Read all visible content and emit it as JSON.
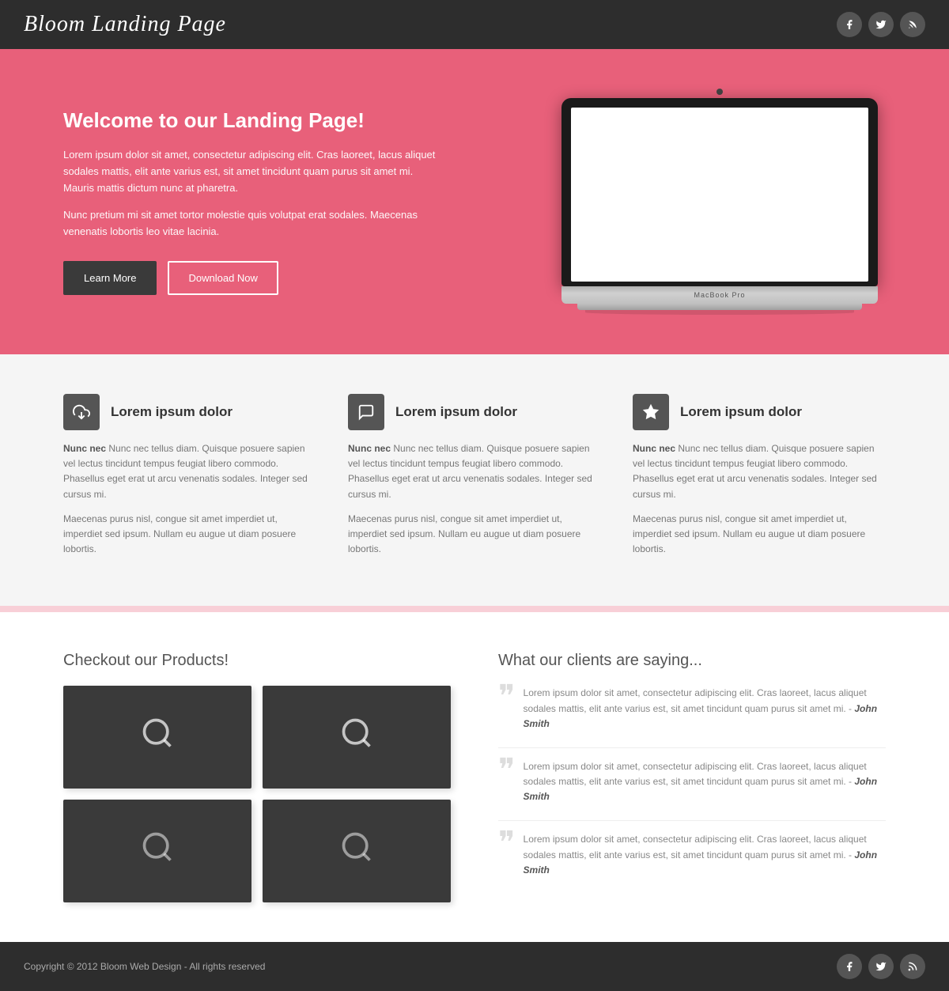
{
  "header": {
    "title": "Bloom Landing Page",
    "social": [
      {
        "name": "facebook",
        "icon": "f"
      },
      {
        "name": "twitter",
        "icon": "t"
      },
      {
        "name": "rss",
        "icon": "rss"
      }
    ]
  },
  "hero": {
    "heading": "Welcome to our Landing Page!",
    "para1": "Lorem ipsum dolor sit amet, consectetur adipiscing elit. Cras laoreet, lacus aliquet sodales mattis, elit ante varius est, sit amet tincidunt quam purus sit amet mi. Mauris mattis dictum nunc at pharetra.",
    "para2": "Nunc pretium mi sit amet tortor molestie quis volutpat erat sodales. Maecenas venenatis lobortis leo vitae lacinia.",
    "btn_learn": "Learn More",
    "btn_download": "Download Now",
    "laptop_label": "MacBook Pro"
  },
  "features": [
    {
      "icon": "cloud_download",
      "title": "Lorem ipsum dolor",
      "body1": "Nunc nec tellus diam. Quisque posuere sapien vel lectus tincidunt tempus feugiat libero commodo. Phasellus eget erat ut arcu venenatis sodales. Integer sed cursus mi.",
      "body2": "Maecenas purus nisl, congue sit amet imperdiet ut, imperdiet sed ipsum. Nullam eu augue ut diam posuere lobortis."
    },
    {
      "icon": "chat",
      "title": "Lorem ipsum dolor",
      "body1": "Nunc nec tellus diam. Quisque posuere sapien vel lectus tincidunt tempus feugiat libero commodo. Phasellus eget erat ut arcu venenatis sodales. Integer sed cursus mi.",
      "body2": "Maecenas purus nisl, congue sit amet imperdiet ut, imperdiet sed ipsum. Nullam eu augue ut diam posuere lobortis."
    },
    {
      "icon": "star",
      "title": "Lorem ipsum dolor",
      "body1": "Nunc nec tellus diam. Quisque posuere sapien vel lectus tincidunt tempus feugiat libero commodo. Phasellus eget erat ut arcu venenatis sodales. Integer sed cursus mi.",
      "body2": "Maecenas purus nisl, congue sit amet imperdiet ut, imperdiet sed ipsum. Nullam eu augue ut diam posuere lobortis."
    }
  ],
  "products": {
    "heading": "Checkout our Products!",
    "items": [
      {
        "alt": "product 1"
      },
      {
        "alt": "product 2"
      },
      {
        "alt": "product 3"
      },
      {
        "alt": "product 4"
      }
    ]
  },
  "testimonials": {
    "heading": "What our clients are saying...",
    "items": [
      {
        "text": "Lorem ipsum dolor sit amet, consectetur adipiscing elit. Cras laoreet, lacus aliquet sodales mattis, elit ante varius est, sit amet tincidunt quam purus sit amet mi.",
        "author": "John Smith"
      },
      {
        "text": "Lorem ipsum dolor sit amet, consectetur adipiscing elit. Cras laoreet, lacus aliquet sodales mattis, elit ante varius est, sit amet tincidunt quam purus sit amet mi.",
        "author": "John Smith"
      },
      {
        "text": "Lorem ipsum dolor sit amet, consectetur adipiscing elit. Cras laoreet, lacus aliquet sodales mattis, elit ante varius est, sit amet tincidunt quam purus sit amet mi.",
        "author": "John Smith"
      }
    ]
  },
  "footer": {
    "copy": "Copyright © 2012 Bloom Web Design - All rights reserved"
  }
}
